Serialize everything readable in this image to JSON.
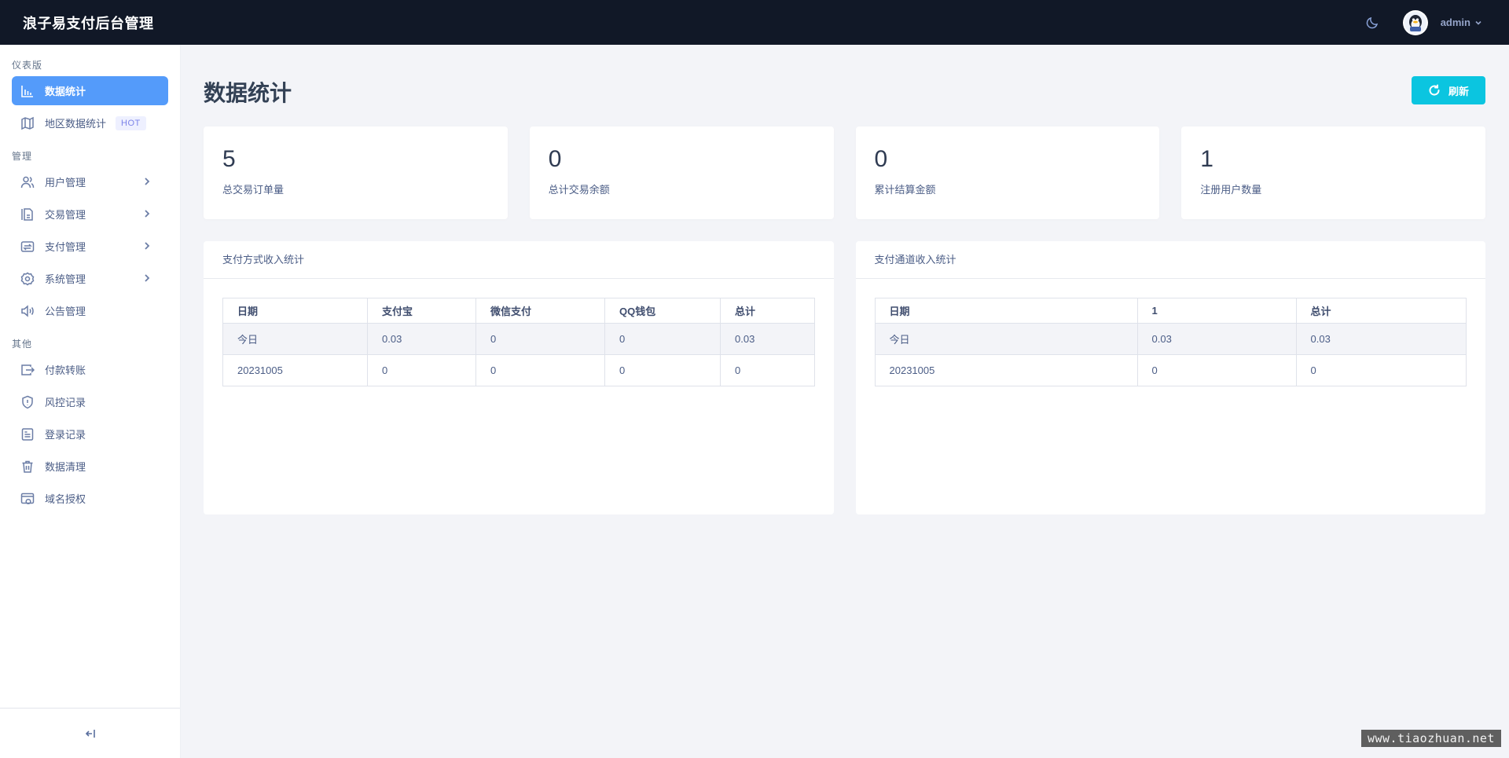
{
  "app": {
    "title": "浪子易支付后台管理"
  },
  "header": {
    "theme_icon": "moon-icon",
    "user_name": "admin"
  },
  "sidebar": {
    "sections": [
      {
        "title": "仪表版",
        "items": [
          {
            "label": "数据统计",
            "icon": "bar-chart-icon",
            "active": true
          },
          {
            "label": "地区数据统计",
            "icon": "map-icon",
            "badge": "HOT"
          }
        ]
      },
      {
        "title": "管理",
        "items": [
          {
            "label": "用户管理",
            "icon": "users-icon",
            "has_children": true
          },
          {
            "label": "交易管理",
            "icon": "document-icon",
            "has_children": true
          },
          {
            "label": "支付管理",
            "icon": "exchange-icon",
            "has_children": true
          },
          {
            "label": "系统管理",
            "icon": "gear-icon",
            "has_children": true
          },
          {
            "label": "公告管理",
            "icon": "speaker-icon"
          }
        ]
      },
      {
        "title": "其他",
        "items": [
          {
            "label": "付款转账",
            "icon": "transfer-out-icon"
          },
          {
            "label": "风控记录",
            "icon": "shield-icon"
          },
          {
            "label": "登录记录",
            "icon": "log-icon"
          },
          {
            "label": "数据清理",
            "icon": "trash-icon"
          },
          {
            "label": "域名授权",
            "icon": "domain-icon"
          }
        ]
      }
    ],
    "collapse_icon": "collapse-left-icon"
  },
  "main": {
    "title": "数据统计",
    "refresh_label": "刷新",
    "stats": [
      {
        "value": "5",
        "label": "总交易订单量"
      },
      {
        "value": "0",
        "label": "总计交易余额"
      },
      {
        "value": "0",
        "label": "累计结算金额"
      },
      {
        "value": "1",
        "label": "注册用户数量"
      }
    ],
    "panels": [
      {
        "title": "支付方式收入统计",
        "columns": [
          "日期",
          "支付宝",
          "微信支付",
          "QQ钱包",
          "总计"
        ],
        "rows": [
          [
            "今日",
            "0.03",
            "0",
            "0",
            "0.03"
          ],
          [
            "20231005",
            "0",
            "0",
            "0",
            "0"
          ]
        ]
      },
      {
        "title": "支付通道收入统计",
        "columns": [
          "日期",
          "1",
          "总计"
        ],
        "rows": [
          [
            "今日",
            "0.03",
            "0.03"
          ],
          [
            "20231005",
            "0",
            "0"
          ]
        ]
      }
    ]
  },
  "watermark": "www.tiaozhuan.net"
}
